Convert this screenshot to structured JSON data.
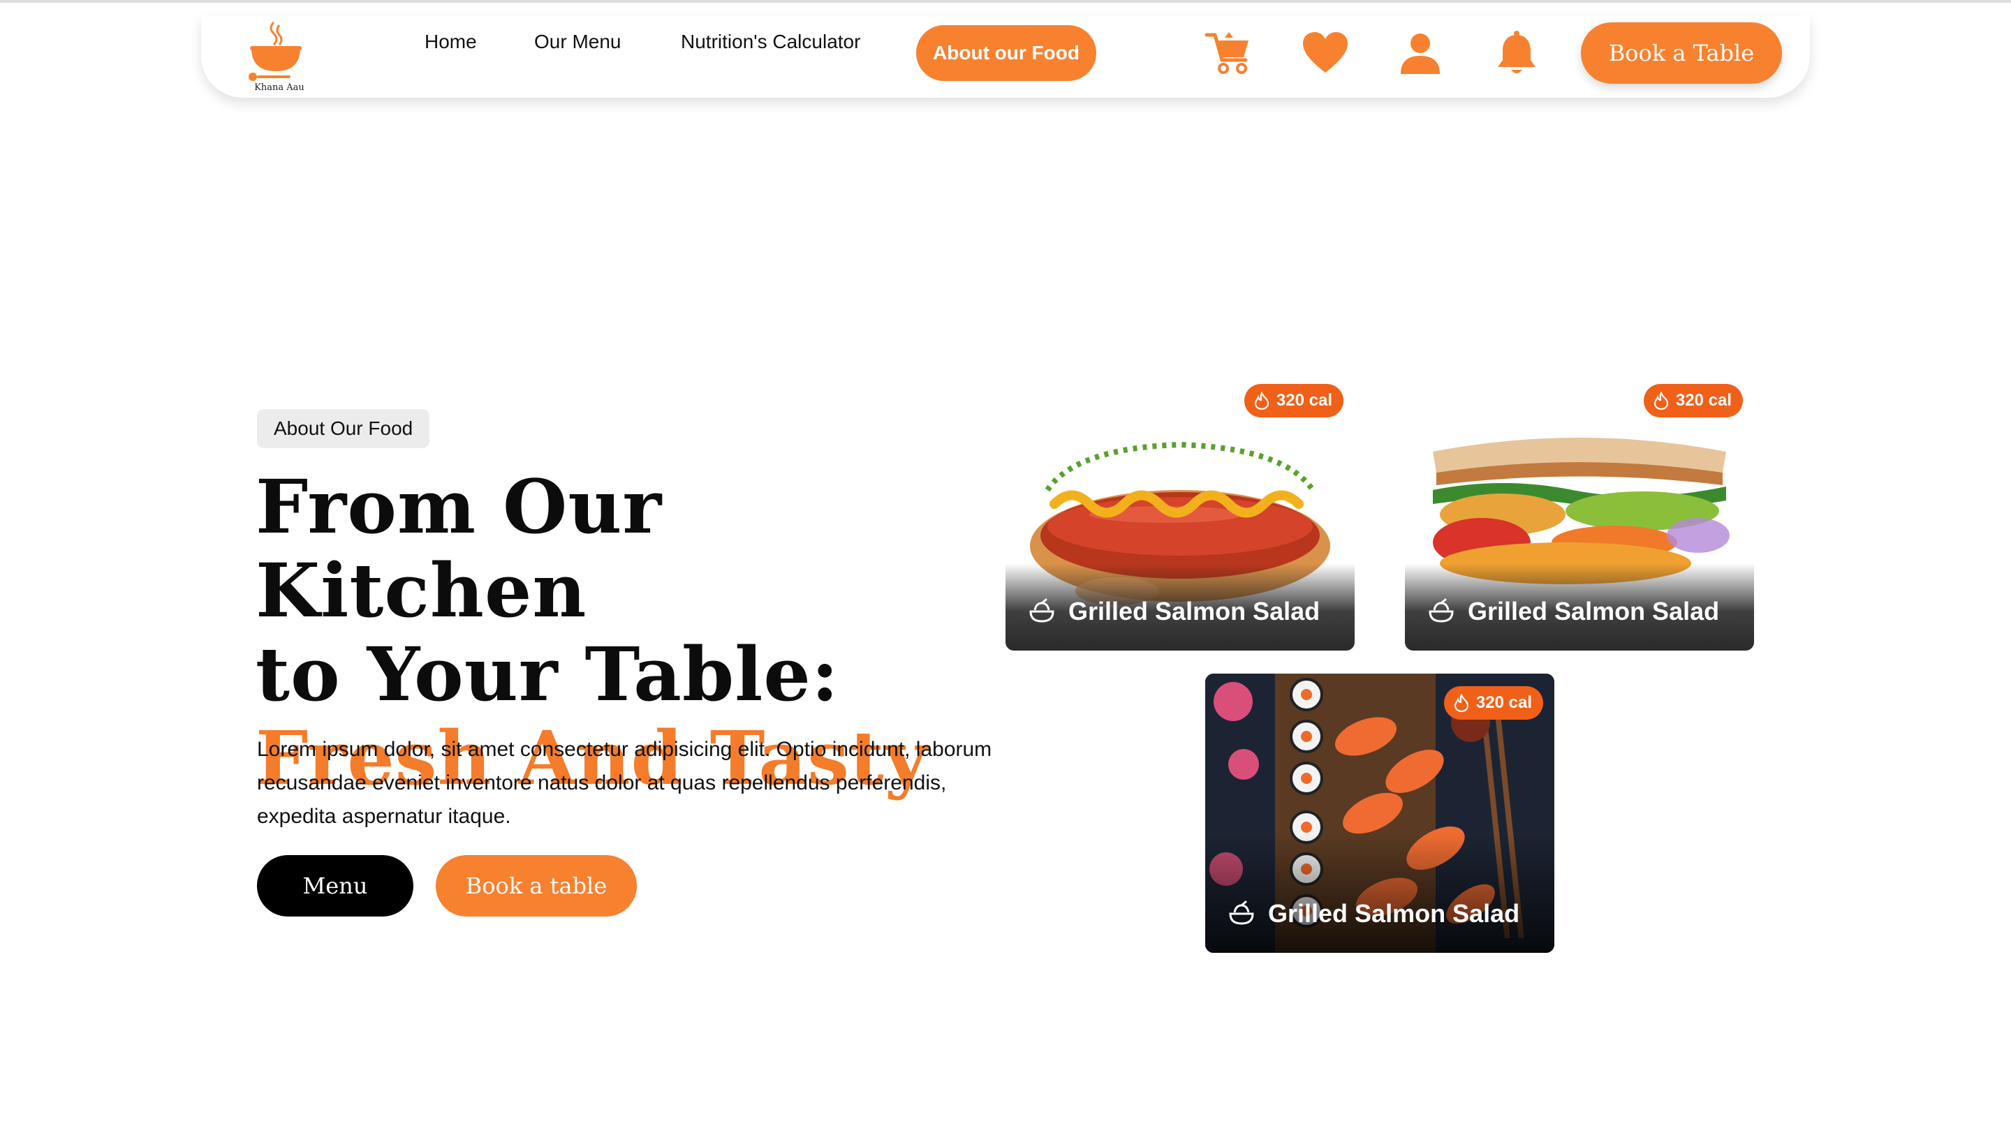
{
  "brand": {
    "name": "Khana Aau",
    "accent": "#f8812f"
  },
  "nav": {
    "links": [
      "Home",
      "Our Menu",
      "Nutrition's Calculator",
      "About our Food"
    ],
    "active": "About our Food",
    "icons": [
      "cart-icon",
      "heart-icon",
      "user-icon",
      "bell-icon"
    ],
    "book_label": "Book a Table"
  },
  "hero": {
    "tag": "About Our Food",
    "headline_line1": "From Our Kitchen",
    "headline_line2": "to Your Table:",
    "headline_accent": "Fresh And Tasty",
    "description": "Lorem ipsum dolor, sit amet consectetur adipisicing elit. Optio incidunt, laborum recusandae eveniet inventore natus dolor at quas repellendus perferendis, expedita aspernatur itaque.",
    "menu_button": "Menu",
    "book_button": "Book a table"
  },
  "cards": [
    {
      "image": "hot dog",
      "title": "Grilled Salmon Salad",
      "calories": "320 cal"
    },
    {
      "image": "sandwich",
      "title": "Grilled Salmon Salad",
      "calories": "320 cal"
    },
    {
      "image": "sushi platter",
      "title": "Grilled Salmon Salad",
      "calories": "320 cal"
    }
  ]
}
